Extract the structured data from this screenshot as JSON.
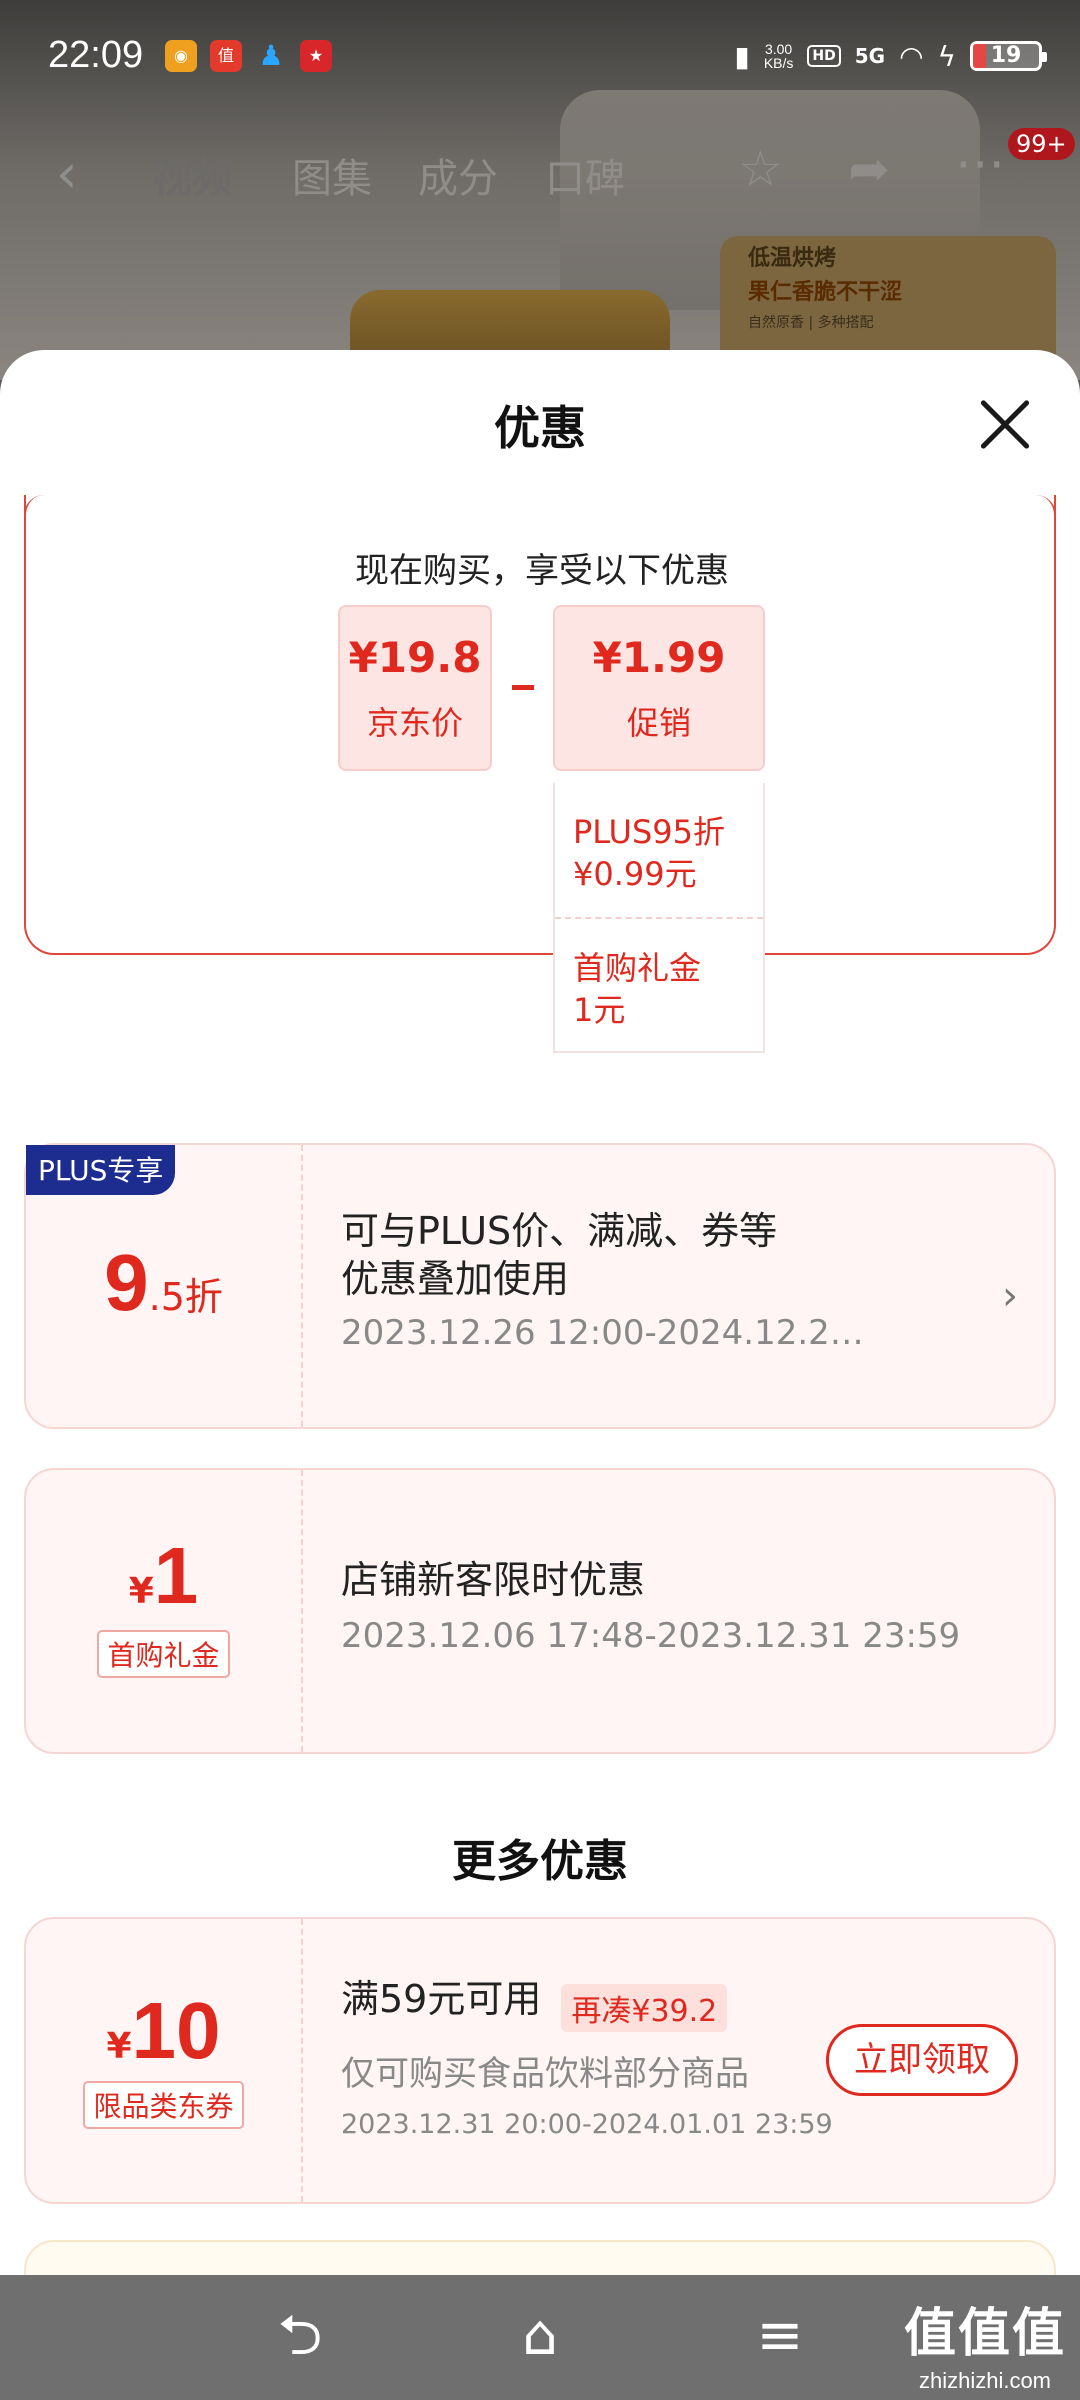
{
  "status_bar": {
    "time": "22:09",
    "net_speed_value": "3.00",
    "net_speed_unit": "KB/s",
    "hd": "HD",
    "network": "5G",
    "battery": "19",
    "battery_color": "#e84545"
  },
  "top_nav": {
    "tabs": [
      {
        "label": "视频",
        "active": true
      },
      {
        "label": "图集"
      },
      {
        "label": "成分"
      },
      {
        "label": "口碑"
      }
    ],
    "badge": "99+"
  },
  "background_promo": {
    "line1": "低温烘烤",
    "line2": "果仁香脆不干涩",
    "line3": "自然原香 | 多种搭配"
  },
  "sheet": {
    "title": "优惠",
    "summary": {
      "heading": "现在购买，享受以下优惠",
      "jd_price": "¥19.8",
      "jd_price_label": "京东价",
      "promo_price": "¥1.99",
      "promo_label": "促销",
      "details": [
        {
          "line1": "PLUS95折",
          "line2": "¥0.99元"
        },
        {
          "line1": "首购礼金",
          "line2": "1元"
        }
      ]
    },
    "coupons": [
      {
        "tag": "PLUS专享",
        "big": "9",
        "unit": ".5折",
        "title_line1": "可与PLUS价、满减、券等",
        "title_line2": "优惠叠加使用",
        "date": "2023.12.26 12:00-2024.12.2…"
      },
      {
        "yen": "¥",
        "big": "1",
        "label": "首购礼金",
        "title": "店铺新客限时优惠",
        "date": "2023.12.06 17:48-2023.12.31 23:59"
      }
    ],
    "more_title": "更多优惠",
    "more_coupons": [
      {
        "yen": "¥",
        "big": "10",
        "label": "限品类东券",
        "title": "满59元可用",
        "gap_tag": "再凑¥39.2",
        "subtitle": "仅可购买食品饮料部分商品",
        "date": "2023.12.31 20:00-2024.01.01 23:59",
        "button": "立即领取"
      }
    ]
  },
  "watermark": {
    "cn": "值值值",
    "en": "zhizhizhi.com"
  },
  "colors": {
    "accent_red": "#e0291e",
    "plus_blue": "#1d2c8f"
  }
}
